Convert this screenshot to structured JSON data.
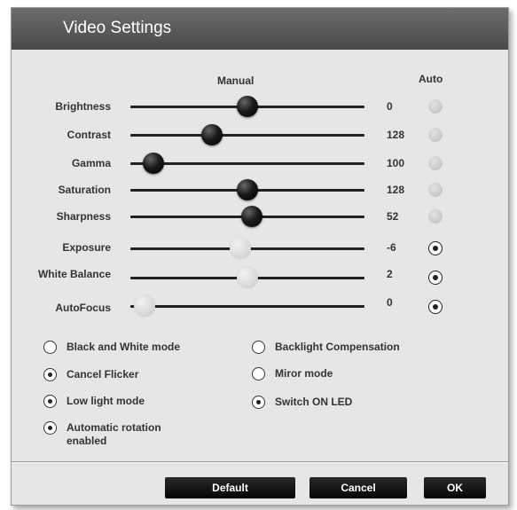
{
  "window": {
    "title": "Video Settings"
  },
  "columns": {
    "manual": "Manual",
    "auto": "Auto"
  },
  "settings": [
    {
      "label": "Brightness",
      "value": "0",
      "slider_fraction": 0.5,
      "enabled": true,
      "auto": false
    },
    {
      "label": "Contrast",
      "value": "128",
      "slider_fraction": 0.35,
      "enabled": true,
      "auto": false
    },
    {
      "label": "Gamma",
      "value": "100",
      "slider_fraction": 0.1,
      "enabled": true,
      "auto": false
    },
    {
      "label": "Saturation",
      "value": "128",
      "slider_fraction": 0.5,
      "enabled": true,
      "auto": false
    },
    {
      "label": "Sharpness",
      "value": "52",
      "slider_fraction": 0.52,
      "enabled": true,
      "auto": false
    },
    {
      "label": "Exposure",
      "value": "-6",
      "slider_fraction": 0.47,
      "enabled": false,
      "auto": true
    },
    {
      "label": "White Balance",
      "value": "2",
      "slider_fraction": 0.5,
      "enabled": false,
      "auto": true
    },
    {
      "label": "AutoFocus",
      "value": "0",
      "slider_fraction": 0.06,
      "enabled": false,
      "auto": true
    }
  ],
  "options": {
    "left": [
      {
        "label": "Black and White mode",
        "checked": false
      },
      {
        "label": "Cancel Flicker",
        "checked": true
      },
      {
        "label": "Low light mode",
        "checked": true
      },
      {
        "label": "Automatic rotation\nenabled",
        "checked": true
      }
    ],
    "right": [
      {
        "label": "Backlight Compensation",
        "checked": false
      },
      {
        "label": "Miror mode",
        "checked": false
      },
      {
        "label": "Switch ON LED",
        "checked": true
      }
    ]
  },
  "buttons": {
    "default": "Default",
    "cancel": "Cancel",
    "ok": "OK"
  }
}
